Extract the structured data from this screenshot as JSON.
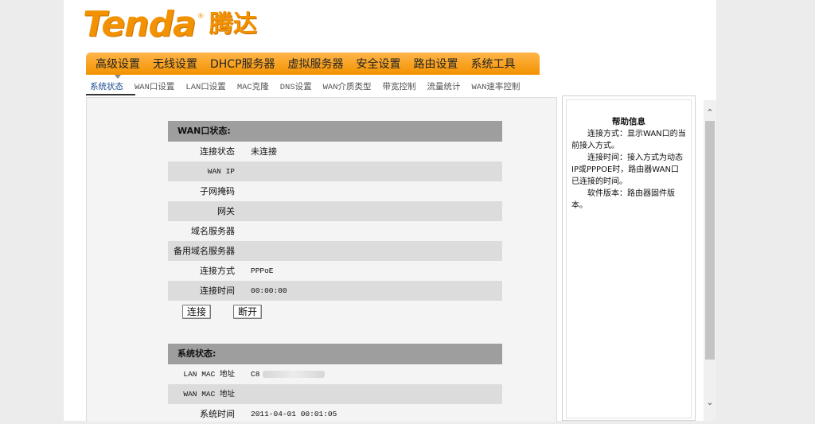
{
  "logo": {
    "latin": "Tenda",
    "reg": "®",
    "cn": "腾达"
  },
  "main_nav": [
    "高级设置",
    "无线设置",
    "DHCP服务器",
    "虚拟服务器",
    "安全设置",
    "路由设置",
    "系统工具"
  ],
  "sub_nav": [
    "系统状态",
    "WAN口设置",
    "LAN口设置",
    "MAC克隆",
    "DNS设置",
    "WAN介质类型",
    "带宽控制",
    "流量统计",
    "WAN速率控制"
  ],
  "wan": {
    "title": "WAN口状态:",
    "rows": [
      {
        "label": "连接状态",
        "value": "未连接"
      },
      {
        "label": "WAN IP",
        "value": ""
      },
      {
        "label": "子网掩码",
        "value": ""
      },
      {
        "label": "网关",
        "value": ""
      },
      {
        "label": "域名服务器",
        "value": ""
      },
      {
        "label": "备用域名服务器",
        "value": ""
      },
      {
        "label": "连接方式",
        "value": "PPPoE"
      },
      {
        "label": "连接时间",
        "value": "00:00:00"
      }
    ],
    "connect_label": "连接",
    "disconnect_label": "断开"
  },
  "system": {
    "title": "系统状态:",
    "rows": [
      {
        "label": "LAN MAC 地址",
        "value": "C8"
      },
      {
        "label": "WAN MAC 地址",
        "value": ""
      },
      {
        "label": "系统时间",
        "value": "2011-04-01 00:01:05"
      }
    ]
  },
  "help": {
    "title": "帮助信息",
    "p1": "连接方式：显示WAN口的当前接入方式。",
    "p2": "连接时间：接入方式为动态IP或PPPOE时，路由器WAN口已连接的时间。",
    "p3": "软件版本：路由器固件版本。"
  }
}
